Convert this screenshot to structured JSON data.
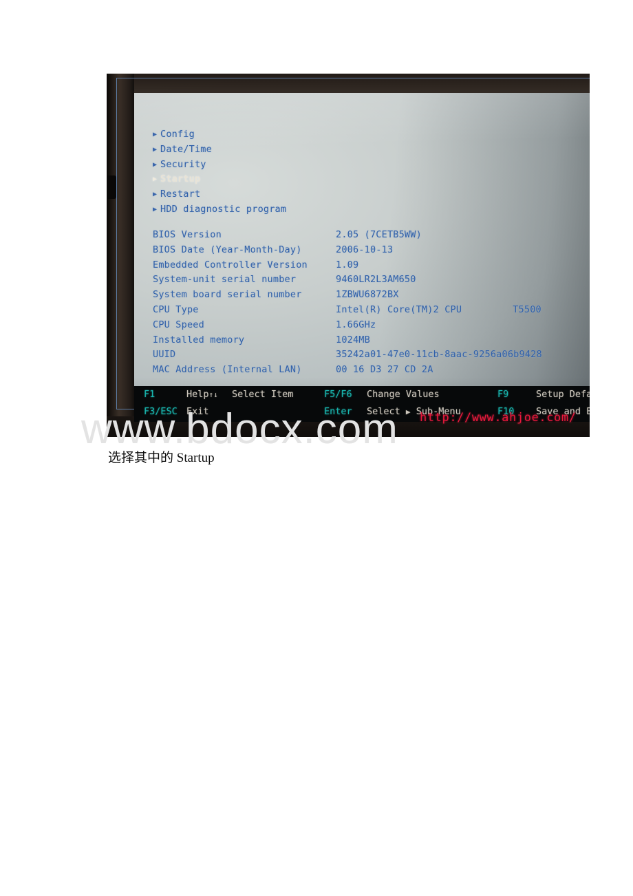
{
  "document": {
    "caption": "选择其中的 Startup",
    "watermark": "www.bdocx.com"
  },
  "bios": {
    "menu": [
      {
        "label": "Config",
        "selected": false
      },
      {
        "label": "Date/Time",
        "selected": false
      },
      {
        "label": "Security",
        "selected": false
      },
      {
        "label": "Startup",
        "selected": true
      },
      {
        "label": "Restart",
        "selected": false
      },
      {
        "label": "HDD diagnostic program",
        "selected": false
      }
    ],
    "info": [
      {
        "label": "BIOS Version",
        "value": "2.05   (7CETB5WW)"
      },
      {
        "label": "BIOS Date (Year-Month-Day)",
        "value": "2006-10-13"
      },
      {
        "label": "Embedded Controller Version",
        "value": "1.09"
      },
      {
        "label": "System-unit serial number",
        "value": "9460LR2L3AM650"
      },
      {
        "label": "System board serial number",
        "value": "1ZBWU6872BX"
      },
      {
        "label": "CPU Type",
        "value": "Intel(R) Core(TM)2 CPU",
        "extra": "T5500"
      },
      {
        "label": "CPU Speed",
        "value": "1.66GHz"
      },
      {
        "label": "Installed memory",
        "value": "1024MB"
      },
      {
        "label": "UUID",
        "value": "35242a01-47e0-11cb-8aac-9256a06b9428"
      },
      {
        "label": "MAC Address (Internal LAN)",
        "value": "00 16 D3 27 CD 2A"
      }
    ],
    "function_keys": {
      "row1": [
        {
          "key": "F1",
          "desc": "Help"
        },
        {
          "key": "",
          "desc": "Select Item"
        },
        {
          "key": "F5/F6",
          "desc": "Change Values"
        },
        {
          "key": "F9",
          "desc": "Setup Defaults"
        }
      ],
      "row2": [
        {
          "key": "F3/ESC",
          "desc": "Exit"
        },
        {
          "key": "Enter",
          "desc": "Select"
        },
        {
          "key": "",
          "desc": "Sub-Menu"
        },
        {
          "key": "F10",
          "desc": "Save and Exit"
        }
      ],
      "help_arrows": "↑↓",
      "submenu_arrow": "▶"
    },
    "red_watermark": "http://www.ahjoe.com/",
    "colors": {
      "text_blue": "#3261a9",
      "selected": "#e8e3d6",
      "fn_key_cyan": "#18b7b0",
      "fn_desc": "#ccc6bb",
      "red": "#e8183c"
    }
  }
}
